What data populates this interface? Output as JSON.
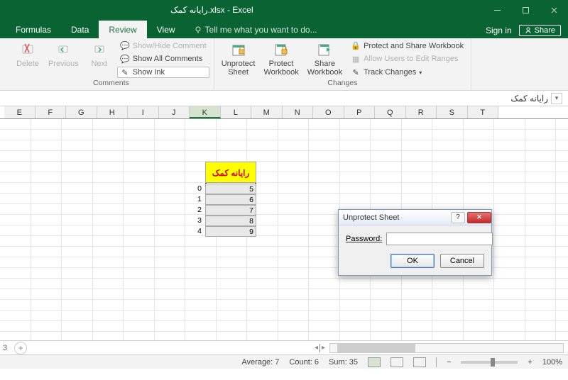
{
  "title": "رایانه کمک.xlsx - Excel",
  "tabs": [
    "Formulas",
    "Data",
    "Review",
    "View"
  ],
  "active_tab": "Review",
  "tellme": "Tell me what you want to do...",
  "signin": "Sign in",
  "share": "Share",
  "ribbon": {
    "comments": {
      "delete": "Delete",
      "previous": "Previous",
      "next": "Next",
      "showhide": "Show/Hide Comment",
      "showall": "Show All Comments",
      "showink": "Show Ink",
      "group": "Comments"
    },
    "changes": {
      "unprotect": "Unprotect\nSheet",
      "protectwb": "Protect\nWorkbook",
      "sharewb": "Share\nWorkbook",
      "protectshare": "Protect and Share Workbook",
      "allowusers": "Allow Users to Edit Ranges",
      "track": "Track Changes",
      "group": "Changes"
    }
  },
  "formula_bar_text": "رایانه کمک",
  "columns": [
    "E",
    "F",
    "G",
    "H",
    "I",
    "J",
    "K",
    "L",
    "M",
    "N",
    "O",
    "P",
    "Q",
    "R",
    "S",
    "T"
  ],
  "table": {
    "header": "رایانه کمک",
    "index": [
      "0",
      "1",
      "2",
      "3",
      "4"
    ],
    "values": [
      "5",
      "6",
      "7",
      "8",
      "9"
    ]
  },
  "status": {
    "average": "Average: 7",
    "count": "Count: 6",
    "sum": "Sum: 35",
    "zoom": "100%"
  },
  "dialog": {
    "title": "Unprotect Sheet",
    "password_label": "Password:",
    "ok": "OK",
    "cancel": "Cancel"
  },
  "sheet": {
    "scroll_end": "3"
  }
}
